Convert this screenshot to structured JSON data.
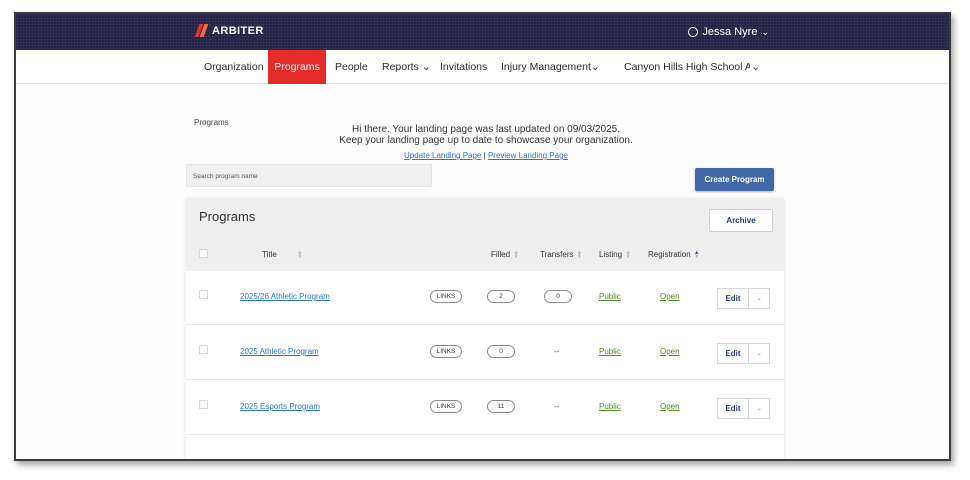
{
  "brand": {
    "name": "ARBITER"
  },
  "user": {
    "name": "Jessa Nyre"
  },
  "nav": {
    "items": [
      {
        "label": "Organization"
      },
      {
        "label": "Programs"
      },
      {
        "label": "People"
      },
      {
        "label": "Reports"
      },
      {
        "label": "Invitations"
      },
      {
        "label": "Injury Management"
      },
      {
        "label": "Canyon Hills High School Acc"
      }
    ]
  },
  "breadcrumb": "Programs",
  "landing": {
    "line1": "Hi there. Your landing page was last updated on 09/03/2025.",
    "line2": "Keep your landing page up to date to showcase your organization.",
    "update_link": "Update Landing Page",
    "separator": "|",
    "preview_link": "Preview Landing Page"
  },
  "search": {
    "placeholder": "Search program name"
  },
  "create_button": "Create Program",
  "panel": {
    "title": "Programs",
    "archive_button": "Archive",
    "columns": {
      "title": "Title",
      "filled": "Filled",
      "transfers": "Transfers",
      "listing": "Listing",
      "registration": "Registration"
    }
  },
  "programs": [
    {
      "title": "2025/26 Athletic Program",
      "links": "LINKS",
      "filled": "2",
      "transfers": "0",
      "listing": "Public",
      "registration": "Open",
      "edit": "Edit"
    },
    {
      "title": "2025 Athletic Program",
      "links": "LINKS",
      "filled": "0",
      "transfers": "--",
      "listing": "Public",
      "registration": "Open",
      "edit": "Edit"
    },
    {
      "title": "2025 Esports Program",
      "links": "LINKS",
      "filled": "11",
      "transfers": "--",
      "listing": "Public",
      "registration": "Open",
      "edit": "Edit"
    }
  ],
  "colors": {
    "topbar": "#242346",
    "active_tab": "#e52a2a",
    "primary_button": "#3f69a8",
    "link": "#2b74c9",
    "green_link": "#4d8b1f"
  },
  "icons": {
    "logo": "arbiter-logo-icon",
    "user": "user-circle-icon",
    "chevron": "chevron-down-icon",
    "sort": "sort-icon",
    "checkbox": "checkbox-icon"
  }
}
